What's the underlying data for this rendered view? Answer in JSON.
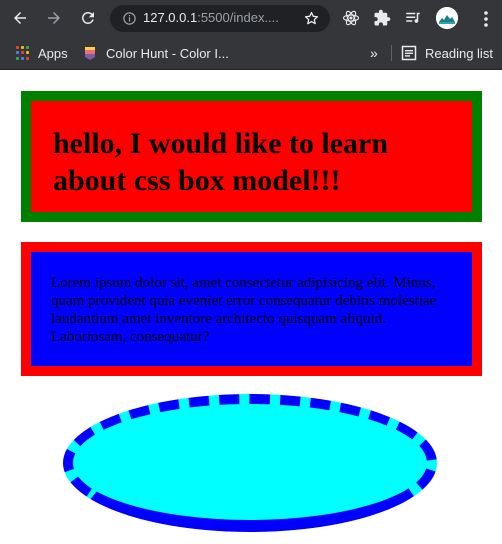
{
  "browser": {
    "url_host": "127.0.0.1",
    "url_rest": ":5500/index....",
    "bookmarks": {
      "apps_label": "Apps",
      "colorhunt_label": "Color Hunt - Color I...",
      "overflow_label": "»",
      "reading_list_label": "Reading list"
    },
    "icons": [
      "back-icon",
      "forward-icon",
      "reload-icon",
      "info-icon",
      "star-icon",
      "react-extension-icon",
      "puzzle-extensions-icon",
      "media-queue-icon",
      "avatar",
      "menu-dots-icon"
    ]
  },
  "page": {
    "heading": "hello, I would like to learn about css box model!!!",
    "paragraph": "Lorem ipsum dolor sit, amet consectetur adipisicing elit. Minus, quam provident quia eveniet error consequatur debitis molestiae laudantium amet inventore architecto quisquam aliquid. Laboriosam, consequatur?",
    "colors": {
      "box1_background": "#ff0000",
      "box1_border": "#008000",
      "box2_background": "#0000ff",
      "box2_border": "#ff0000",
      "ellipse_background": "#00ffff",
      "ellipse_border": "#0000ff"
    }
  }
}
